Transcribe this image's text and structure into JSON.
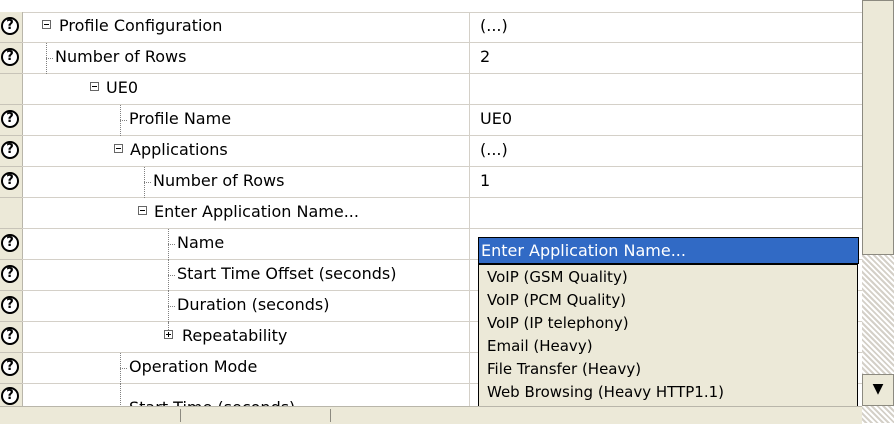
{
  "rows": [
    {
      "label": "Profile Configuration",
      "value": "(...)",
      "help": true,
      "expander": "minus"
    },
    {
      "label": "Number of Rows",
      "value": "2",
      "help": true,
      "expander": "leaf"
    },
    {
      "label": "UE0",
      "value": "",
      "help": false,
      "expander": "minus"
    },
    {
      "label": "Profile Name",
      "value": "UE0",
      "help": true,
      "expander": "leaf"
    },
    {
      "label": "Applications",
      "value": "(...)",
      "help": true,
      "expander": "minus"
    },
    {
      "label": "Number of Rows",
      "value": "1",
      "help": true,
      "expander": "leaf"
    },
    {
      "label": "Enter Application Name...",
      "value": "",
      "help": false,
      "expander": "minus"
    },
    {
      "label": "Name",
      "value": "",
      "help": true,
      "expander": "leaf"
    },
    {
      "label": "Start Time Offset (seconds)",
      "value": "",
      "help": true,
      "expander": "leaf"
    },
    {
      "label": "Duration (seconds)",
      "value": "",
      "help": true,
      "expander": "leaf"
    },
    {
      "label": "Repeatability",
      "value": "",
      "help": true,
      "expander": "plus"
    },
    {
      "label": "Operation Mode",
      "value": "",
      "help": true,
      "expander": "leaf"
    },
    {
      "label": "Start Time (seconds)",
      "value": "",
      "help": true,
      "expander": "leaf"
    }
  ],
  "help_icon": "help-question-icon",
  "help_glyph": "?",
  "name_field": {
    "value": "Enter Application Name..."
  },
  "dropdown_options": [
    "VoIP (GSM Quality)",
    "VoIP (PCM Quality)",
    "VoIP (IP telephony)",
    "Email (Heavy)",
    "File Transfer (Heavy)",
    "Web Browsing (Heavy HTTP1.1)"
  ],
  "scroll_down_glyph": "▼",
  "colors": {
    "selection": "#316ac5",
    "panel": "#ece9d8",
    "grid_line": "#d4d0c8"
  }
}
